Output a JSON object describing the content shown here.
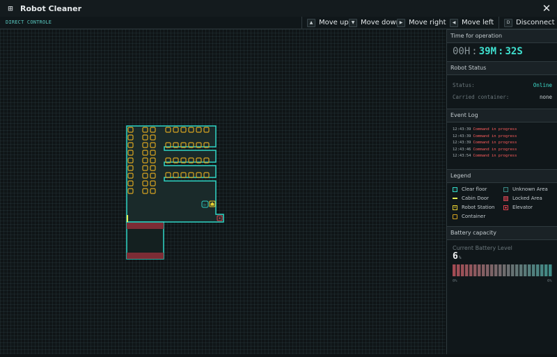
{
  "window": {
    "title": "Robot Cleaner",
    "app_icon": "grid-icon",
    "close_icon": "close-icon"
  },
  "toolbar": {
    "mode_label": "DIRECT CONTROLE",
    "controls": [
      {
        "label": "Move up",
        "key": "▲",
        "icon": "arrow-up-icon"
      },
      {
        "label": "Move down",
        "key": "▼",
        "icon": "arrow-down-icon"
      },
      {
        "label": "Move right",
        "key": "▶",
        "icon": "arrow-right-icon"
      },
      {
        "label": "Move left",
        "key": "◀",
        "icon": "arrow-left-icon"
      },
      {
        "label": "Disconnect",
        "key": "D",
        "icon": "key-d-icon"
      }
    ]
  },
  "operation": {
    "header": "Time for operation",
    "hours": "00H",
    "minutes": "39M",
    "seconds": "32S"
  },
  "robot_status": {
    "header": "Robot Status",
    "status_label": "Status:",
    "status_value": "Online",
    "container_label": "Carried container:",
    "container_value": "none"
  },
  "event_log": {
    "header": "Event Log",
    "entries": [
      {
        "time": "12:43:39",
        "message": "Command in progress"
      },
      {
        "time": "12:43:39",
        "message": "Command in progress"
      },
      {
        "time": "12:43:39",
        "message": "Command in progress"
      },
      {
        "time": "12:43:46",
        "message": "Command in progress"
      },
      {
        "time": "12:43:54",
        "message": "Command in progress"
      }
    ]
  },
  "legend": {
    "header": "Legend",
    "items": [
      {
        "label": "Clear floor",
        "color": "#2fd6c6",
        "icon": "clear-floor-swatch"
      },
      {
        "label": "Unknown Area",
        "color": "#3a8a86",
        "icon": "unknown-area-swatch"
      },
      {
        "label": "Cabin Door",
        "color": "#e6ef55",
        "icon": "cabin-door-swatch"
      },
      {
        "label": "Locked Area",
        "color": "#b8434f",
        "icon": "locked-area-swatch"
      },
      {
        "label": "Robot Station",
        "color": "#e8d030",
        "icon": "robot-station-icon"
      },
      {
        "label": "Elevator",
        "color": "#e2404e",
        "icon": "elevator-icon"
      },
      {
        "label": "Container",
        "color": "#d9a520",
        "icon": "container-swatch"
      }
    ]
  },
  "battery": {
    "header": "Battery capacity",
    "label": "Current Battery Level",
    "value": "6",
    "unit": "%",
    "level": 0.06,
    "min_label": "0%",
    "max_label": "6%",
    "bar_count": 24
  },
  "colors": {
    "accent": "#2fd6c6",
    "container": "#d9a520",
    "locked": "#7d2c35",
    "floor": "#1a2a2a",
    "danger_text": "#ff5c5c"
  }
}
